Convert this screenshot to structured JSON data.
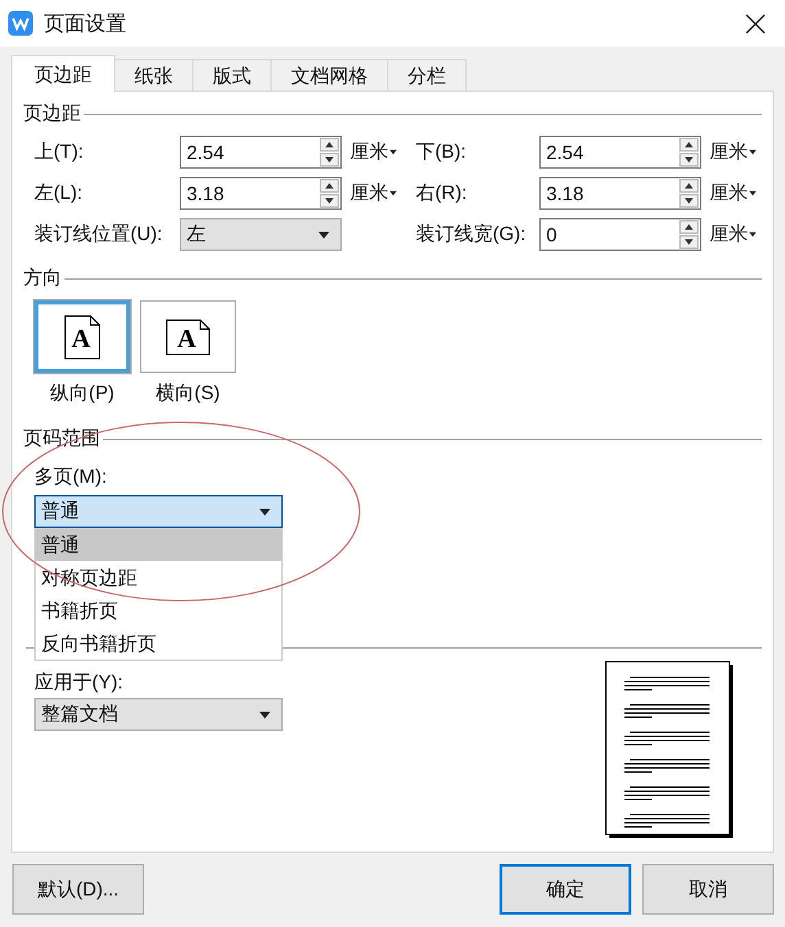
{
  "window": {
    "title": "页面设置"
  },
  "tabs": [
    {
      "label": "页边距",
      "selected": true
    },
    {
      "label": "纸张",
      "selected": false
    },
    {
      "label": "版式",
      "selected": false
    },
    {
      "label": "文档网格",
      "selected": false
    },
    {
      "label": "分栏",
      "selected": false
    }
  ],
  "margins": {
    "heading": "页边距",
    "fields": [
      {
        "kind": "spin",
        "label": "上(T):",
        "value": "2.54",
        "unit": "厘米"
      },
      {
        "kind": "spin",
        "label": "下(B):",
        "value": "2.54",
        "unit": "厘米"
      },
      {
        "kind": "spin",
        "label": "左(L):",
        "value": "3.18",
        "unit": "厘米"
      },
      {
        "kind": "spin",
        "label": "右(R):",
        "value": "3.18",
        "unit": "厘米"
      },
      {
        "kind": "select",
        "label": "装订线位置(U):",
        "value": "左"
      },
      {
        "kind": "spin",
        "label": "装订线宽(G):",
        "value": "0",
        "unit": "厘米"
      }
    ]
  },
  "orientation": {
    "heading": "方向",
    "options": [
      {
        "label": "纵向(P)",
        "selected": true,
        "kind": "portrait",
        "icon_letter": "A"
      },
      {
        "label": "横向(S)",
        "selected": false,
        "kind": "landscape",
        "icon_letter": "A"
      }
    ]
  },
  "page_range": {
    "heading": "页码范围",
    "label": "多页(M):",
    "value": "普通",
    "expanded": true,
    "options": [
      {
        "label": "普通",
        "selected": true
      },
      {
        "label": "对称页边距",
        "selected": false
      },
      {
        "label": "书籍折页",
        "selected": false
      },
      {
        "label": "反向书籍折页",
        "selected": false
      }
    ]
  },
  "preview": {
    "apply_label": "应用于(Y):",
    "apply_value": "整篇文档"
  },
  "buttons": [
    {
      "label": "默认(D)...",
      "kind": "normal"
    },
    {
      "label": "确定",
      "kind": "primary"
    },
    {
      "label": "取消",
      "kind": "normal"
    }
  ]
}
